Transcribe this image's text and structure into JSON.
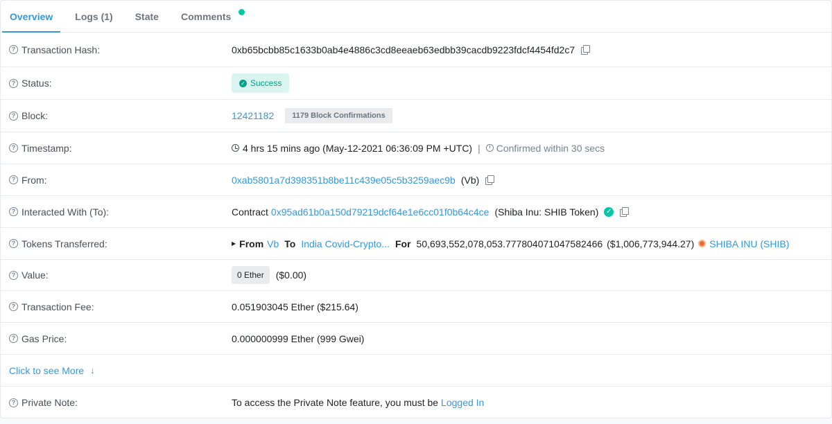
{
  "tabs": [
    {
      "label": "Overview"
    },
    {
      "label": "Logs (1)"
    },
    {
      "label": "State"
    },
    {
      "label": "Comments"
    }
  ],
  "rows": {
    "tx_hash": {
      "label": "Transaction Hash:",
      "value": "0xb65bcbb85c1633b0ab4e4886c3cd8eeaeb63edbb39cacdb9223fdcf4454fd2c7"
    },
    "status": {
      "label": "Status:",
      "value": "Success"
    },
    "block": {
      "label": "Block:",
      "value": "12421182",
      "confirmations": "1179 Block Confirmations"
    },
    "timestamp": {
      "label": "Timestamp:",
      "value": "4 hrs 15 mins ago (May-12-2021 06:36:09 PM +UTC)",
      "separator": "|",
      "confirmed": "Confirmed within 30 secs"
    },
    "from": {
      "label": "From:",
      "address": "0xab5801a7d398351b8be11c439e05c5b3259aec9b",
      "tag": "(Vb)"
    },
    "to": {
      "label": "Interacted With (To):",
      "prefix": "Contract",
      "address": "0x95ad61b0a150d79219dcf64e1e6cc01f0b64c4ce",
      "tag": "(Shiba Inu: SHIB Token)"
    },
    "tokens": {
      "label": "Tokens Transferred:",
      "from_label": "From",
      "from_value": "Vb",
      "to_label": "To",
      "to_value": "India Covid-Crypto...",
      "for_label": "For",
      "amount": "50,693,552,078,053.77780407104758246​6",
      "usd": "($1,006,773,944.27)",
      "token": "SHIBA INU (SHIB)"
    },
    "value": {
      "label": "Value:",
      "badge": "0 Ether",
      "usd": "($0.00)"
    },
    "fee": {
      "label": "Transaction Fee:",
      "value": "0.051903045 Ether ($215.64)"
    },
    "gas": {
      "label": "Gas Price:",
      "value": "0.000000999 Ether (999 Gwei)"
    },
    "more": {
      "label": "Click to see More"
    },
    "note": {
      "label": "Private Note:",
      "text": "To access the Private Note feature, you must be",
      "link": "Logged In"
    }
  },
  "icons": {
    "help": "?",
    "check": "✓",
    "arrow_down": "↓",
    "caret_right": "▶"
  },
  "colors": {
    "accent": "#3498db",
    "success": "#00a186",
    "success_bg": "#daf4ef",
    "notification": "#00c9a7"
  }
}
